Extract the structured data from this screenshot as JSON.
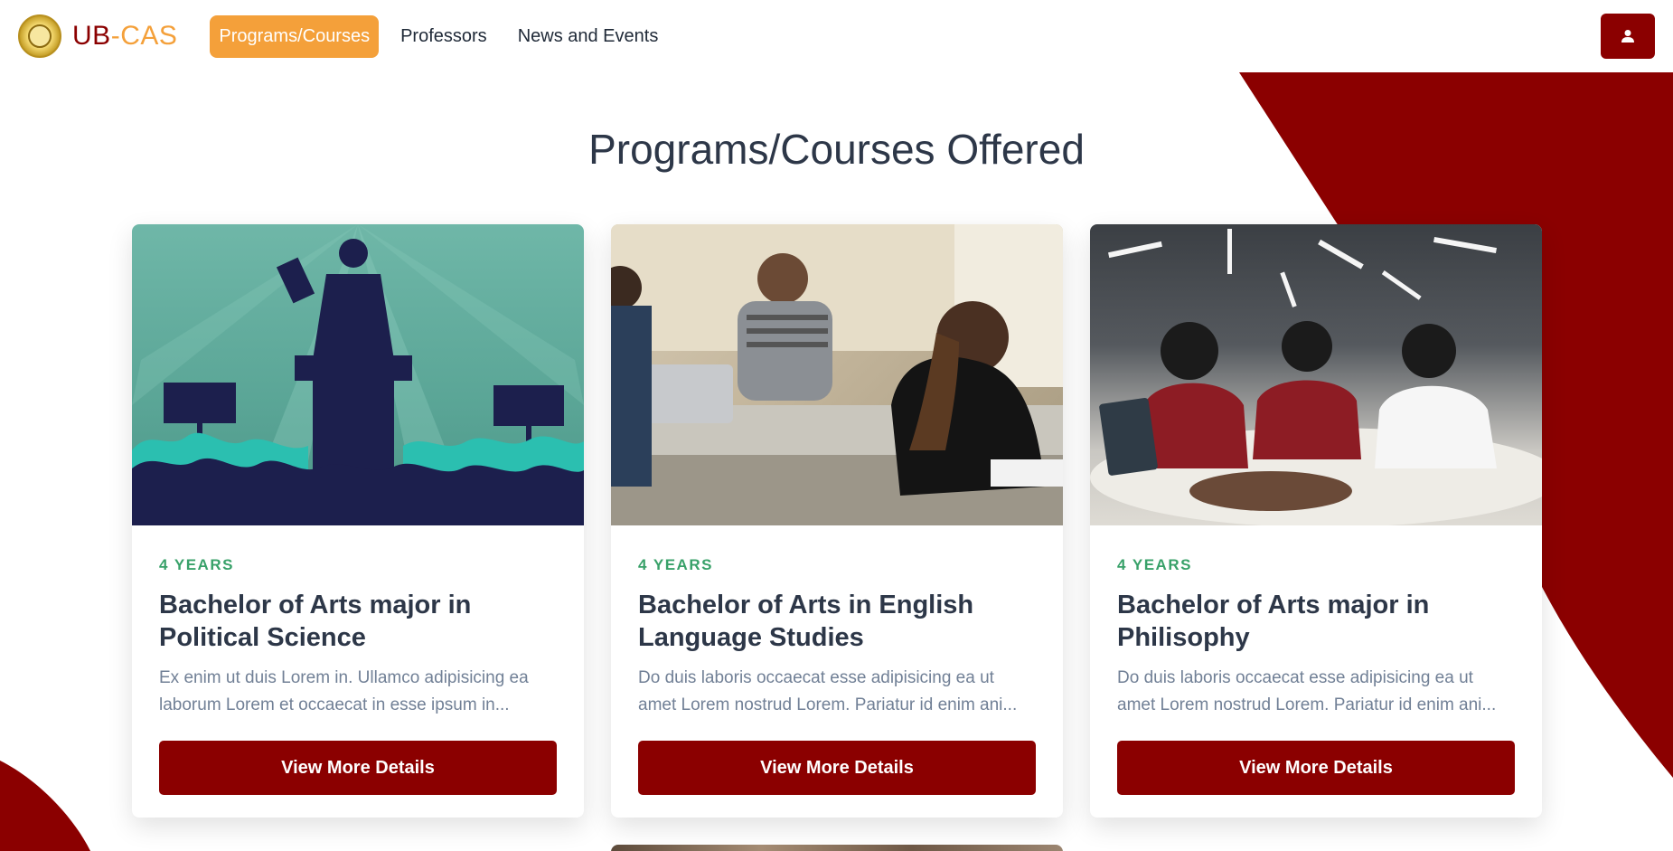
{
  "app": {
    "brand_ub": "UB",
    "brand_dash": "-",
    "brand_cas": "CAS",
    "logo_icon": "university-seal-icon",
    "accent_color": "#8b0000",
    "highlight_color": "#f4a03a"
  },
  "nav": {
    "items": [
      {
        "label": "Programs/Courses",
        "active": true
      },
      {
        "label": "Professors",
        "active": false
      },
      {
        "label": "News and Events",
        "active": false
      }
    ],
    "user_icon": "user-icon"
  },
  "main": {
    "title": "Programs/Courses Offered",
    "cards": [
      {
        "duration": "4 YEARS",
        "title": "Bachelor of Arts major in Political Science",
        "description": "Ex enim ut duis Lorem in. Ullamco adipisicing ea laborum Lorem et occaecat in esse ipsum in...",
        "button": "View More Details",
        "image": "speaker-crowd-illustration"
      },
      {
        "duration": "4 YEARS",
        "title": "Bachelor of Arts in English Language Studies",
        "description": "Do duis laboris occaecat esse adipisicing ea ut amet Lorem nostrud Lorem. Pariatur id enim ani...",
        "button": "View More Details",
        "image": "students-classroom-photo"
      },
      {
        "duration": "4 YEARS",
        "title": "Bachelor of Arts major in Philisophy",
        "description": "Do duis laboris occaecat esse adipisicing ea ut amet Lorem nostrud Lorem. Pariatur id enim ani...",
        "button": "View More Details",
        "image": "students-laughing-photo"
      }
    ]
  }
}
